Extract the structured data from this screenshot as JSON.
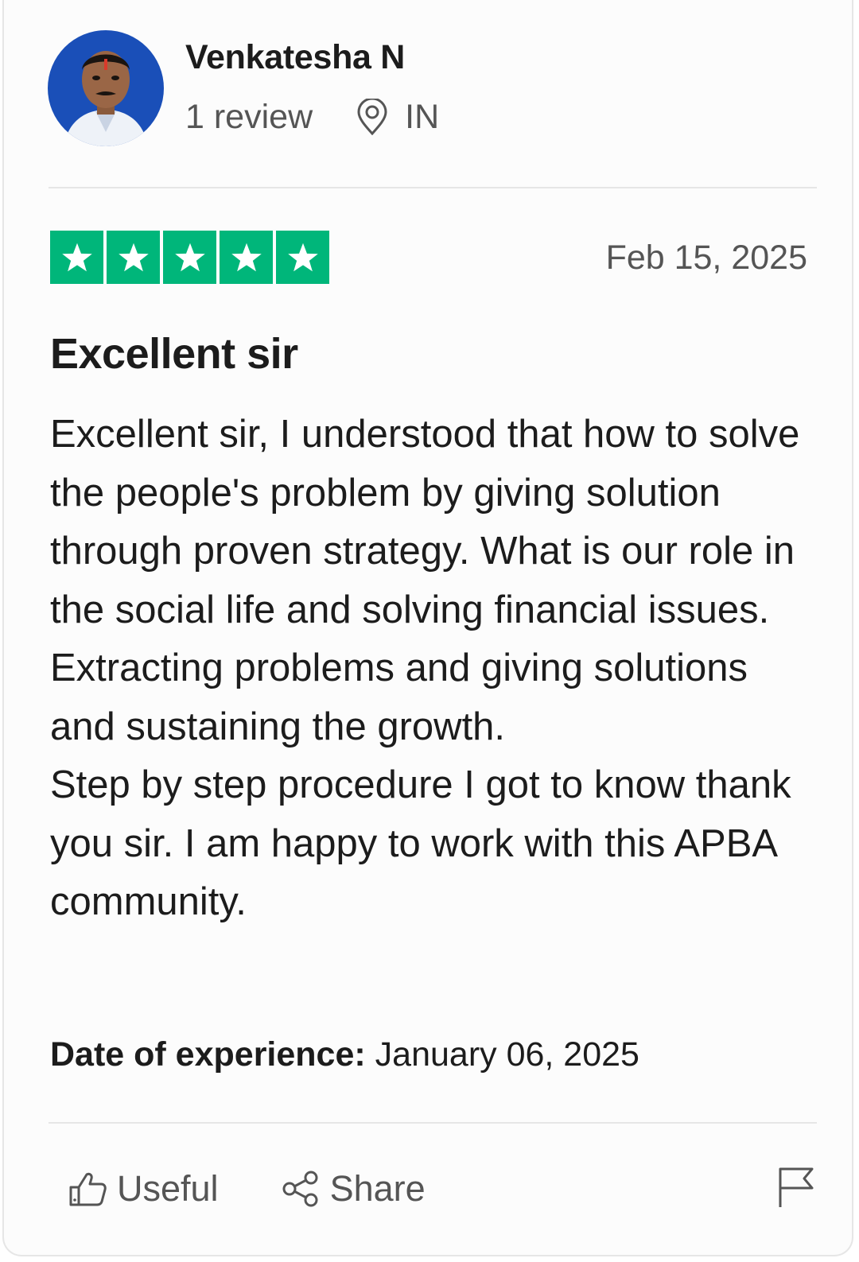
{
  "reviewer": {
    "name": "Venkatesha N",
    "review_count": "1 review",
    "country": "IN"
  },
  "review": {
    "rating": 5,
    "rating_max": 5,
    "date": "Feb 15, 2025",
    "title": "Excellent sir",
    "body": [
      "Excellent sir, I understood that how to solve the people's problem by giving solution through proven strategy. What is our role in the social life and solving financial issues. Extracting problems and giving solutions and sustaining the growth.",
      "Step by step procedure I got to know thank you sir. I am happy to work with this APBA community."
    ],
    "experience_label": "Date of experience:",
    "experience_date": "January 06, 2025"
  },
  "actions": {
    "useful_label": "Useful",
    "share_label": "Share"
  },
  "colors": {
    "star_green": "#00b67a",
    "text_dark": "#1c1c1c",
    "text_muted": "#555555",
    "divider": "#e6e6e6"
  },
  "icons": {
    "location": "map-pin-icon",
    "useful": "thumbs-up-icon",
    "share": "share-icon",
    "report": "flag-icon",
    "star": "star-icon"
  }
}
